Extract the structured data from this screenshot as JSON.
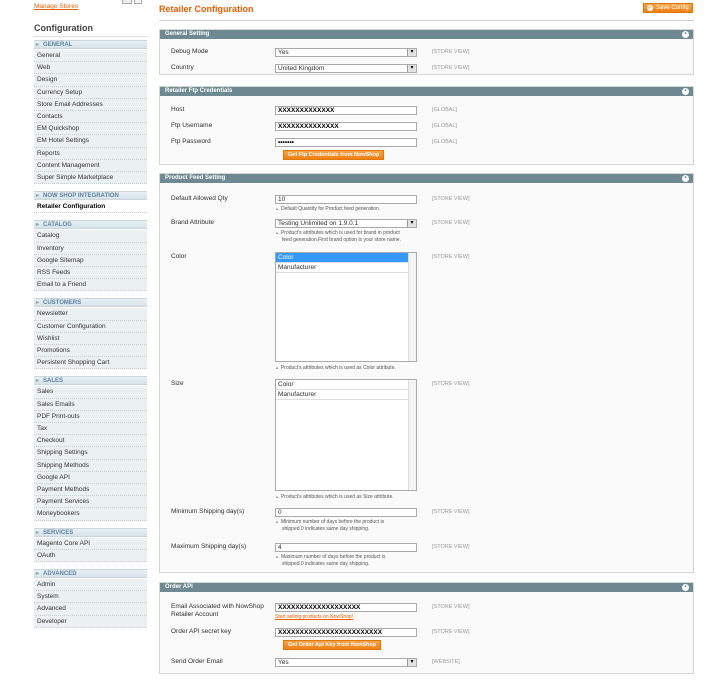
{
  "sidebar": {
    "manage_stores": "Manage Stores",
    "title": "Configuration",
    "groups": [
      {
        "name": "GENERAL",
        "items": [
          "General",
          "Web",
          "Design",
          "Currency Setup",
          "Store Email Addresses",
          "Contacts",
          "EM Quickshop",
          "EM Hotel Settings",
          "Reports",
          "Content Management",
          "Super Simple Marketplace"
        ]
      },
      {
        "name": "NOW SHOP INTEGRATION",
        "items": [
          "Retailer Configuration"
        ]
      },
      {
        "name": "CATALOG",
        "items": [
          "Catalog",
          "Inventory",
          "Google Sitemap",
          "RSS Feeds",
          "Email to a Friend"
        ]
      },
      {
        "name": "CUSTOMERS",
        "items": [
          "Newsletter",
          "Customer Configuration",
          "Wishlist",
          "Promotions",
          "Persistent Shopping Cart"
        ]
      },
      {
        "name": "SALES",
        "items": [
          "Sales",
          "Sales Emails",
          "PDF Print-outs",
          "Tax",
          "Checkout",
          "Shipping Settings",
          "Shipping Methods",
          "Google API",
          "Payment Methods",
          "Payment Services",
          "Moneybookers"
        ]
      },
      {
        "name": "SERVICES",
        "items": [
          "Magento Core API",
          "OAuth"
        ]
      },
      {
        "name": "ADVANCED",
        "items": [
          "Admin",
          "System",
          "Advanced",
          "Developer"
        ]
      }
    ]
  },
  "header": {
    "title": "Retailer Configuration",
    "save": "Save Config"
  },
  "general": {
    "heading": "General Setting",
    "debug_label": "Debug Mode",
    "debug_value": "Yes",
    "debug_scope": "[STORE VIEW]",
    "country_label": "Country",
    "country_value": "United Kingdom",
    "country_scope": "[STORE VIEW]"
  },
  "ftp": {
    "heading": "Retailer Ftp Credentials",
    "host_label": "Host",
    "host_value": "XXXXXXXXXXXXX",
    "host_scope": "[GLOBAL]",
    "user_label": "Ftp Username",
    "user_value": "XXXXXXXXXXXXXX",
    "user_scope": "[GLOBAL]",
    "pass_label": "Ftp Password",
    "pass_value": "•••••••",
    "pass_scope": "[GLOBAL]",
    "button": "Get Ftp Credentials from NowShop"
  },
  "feed": {
    "heading": "Product Feed Setting",
    "qty_label": "Default Allowed Qty",
    "qty_value": "10",
    "qty_note": "Default Quantity for Product feed generation.",
    "qty_scope": "[STORE VIEW]",
    "brand_label": "Brand Attribute",
    "brand_value": "Testing Unlimited on 1.9.0.1",
    "brand_note1": "Product's attributes which is used for brand in product",
    "brand_note2": "feed generation.First brand option is your store name.",
    "brand_scope": "[STORE VIEW]",
    "color_label": "Color",
    "color_options": [
      "Color",
      "Manufacturer"
    ],
    "color_note": "Product's attributes which is used as Color attribute.",
    "color_scope": "[STORE VIEW]",
    "size_label": "Size",
    "size_options": [
      "Color",
      "Manufacturer"
    ],
    "size_note": "Product's attributes which is used as Size attribute.",
    "size_scope": "[STORE VIEW]",
    "min_label": "Minimum Shipping day(s)",
    "min_value": "0",
    "min_note1": "Minimum number of days before the product is",
    "min_note2": "shipped.0 indicates same day shipping.",
    "min_scope": "[STORE VIEW]",
    "max_label": "Maximum Shipping day(s)",
    "max_value": "4",
    "max_note1": "Maximum number of days before the product is",
    "max_note2": "shipped.0 indicates same day shipping.",
    "max_scope": "[STORE VIEW]"
  },
  "order": {
    "heading": "Order API",
    "email_label1": "Email Associated with NowShop",
    "email_label2": "Retailer Account",
    "email_value": "XXXXXXXXXXXXXXXXXXX",
    "email_link": "Start selling products on NowShop!",
    "email_scope": "[STORE VIEW]",
    "key_label": "Order API secret key",
    "key_value": "XXXXXXXXXXXXXXXXXXXXXXXX",
    "key_scope": "[STORE VIEW]",
    "key_button": "Get Order Api Key from NowShop",
    "send_label": "Send Order Email",
    "send_value": "Yes",
    "send_scope": "[WEBSITE]"
  }
}
